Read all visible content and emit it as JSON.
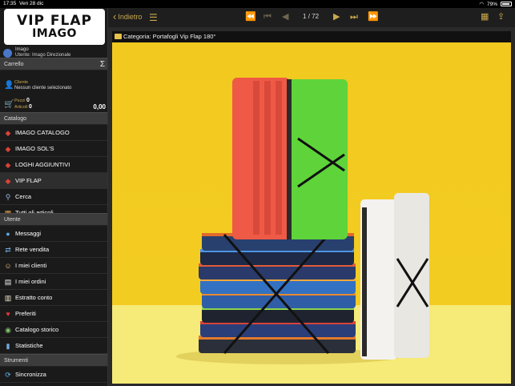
{
  "status_bar": {
    "time": "17:35",
    "date": "Ven 28 dic",
    "battery": "79%"
  },
  "logo": {
    "line1": "VIP FLAP",
    "line2": "IMAGO"
  },
  "user": {
    "name": "Imago",
    "subtitle": "Utente: Imago Direzionale"
  },
  "sidebar": {
    "carrello_header": "Carrello",
    "sigma": "Σ",
    "cliente_label": "Cliente",
    "cliente_value": "Nessun cliente selezionato",
    "pezzi_label": "Pezzi",
    "pezzi_value": "0",
    "articoli_label": "Articoli",
    "articoli_value": "0",
    "cart_total": "0,00",
    "catalogo_header": "Catalogo",
    "catalogo_items": [
      {
        "label": "IMAGO CATALOGO",
        "icon": "tag-icon"
      },
      {
        "label": "IMAGO SOL'S",
        "icon": "tag-icon"
      },
      {
        "label": "LOGHI AGGIUNTIVI",
        "icon": "tag-icon"
      },
      {
        "label": "VIP FLAP",
        "icon": "tag-icon",
        "active": true
      },
      {
        "label": "Cerca",
        "icon": "search-icon"
      },
      {
        "label": "Tutti gli articoli",
        "icon": "grid-icon"
      }
    ],
    "utente_header": "Utente",
    "utente_items": [
      {
        "label": "Messaggi",
        "icon": "message-icon"
      },
      {
        "label": "Rete vendita",
        "icon": "network-icon"
      },
      {
        "label": "I miei clienti",
        "icon": "clients-icon"
      },
      {
        "label": "I miei ordini",
        "icon": "orders-icon"
      },
      {
        "label": "Estratto conto",
        "icon": "statement-icon"
      },
      {
        "label": "Preferiti",
        "icon": "heart-icon"
      },
      {
        "label": "Catalogo storico",
        "icon": "history-icon"
      },
      {
        "label": "Statistiche",
        "icon": "stats-icon"
      }
    ],
    "strumenti_header": "Strumenti",
    "strumenti_items": [
      {
        "label": "Sincronizza",
        "icon": "sync-icon"
      }
    ]
  },
  "toolbar": {
    "back_label": "Indietro",
    "page_current": "1",
    "page_total": "72",
    "page_separator": "/"
  },
  "content": {
    "caption": "Categoria: Portafogli Vip Flap 180°"
  },
  "colors": {
    "accent": "#c9a84c",
    "background_yellow": "#f2c91f",
    "sidebar_bg": "#1a1a1a"
  }
}
